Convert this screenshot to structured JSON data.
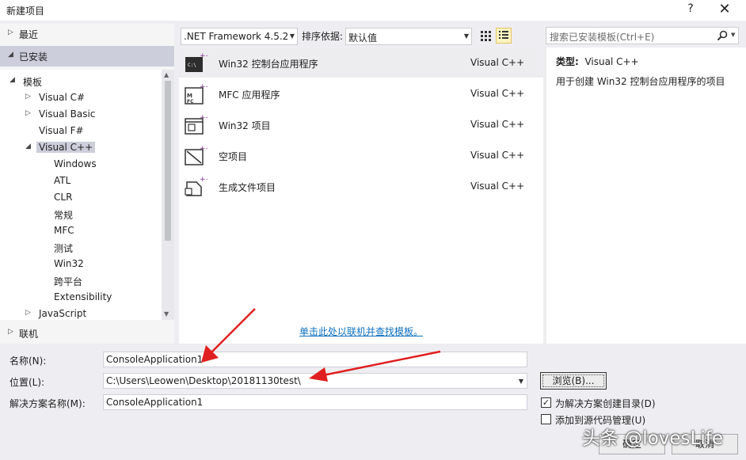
{
  "window": {
    "title": "新建项目",
    "help": "?",
    "close": "✕"
  },
  "left": {
    "recent": "最近",
    "installed": "已安装",
    "online": "联机",
    "tree": [
      {
        "label": "模板",
        "arrow": "◢",
        "indent": 12
      },
      {
        "label": "Visual C#",
        "arrow": "▷",
        "indent": 32
      },
      {
        "label": "Visual Basic",
        "arrow": "▷",
        "indent": 32
      },
      {
        "label": "Visual F#",
        "arrow": "",
        "indent": 32
      },
      {
        "label": "Visual C++",
        "arrow": "◢",
        "indent": 32,
        "selected": true
      },
      {
        "label": "Windows",
        "arrow": "",
        "indent": 51
      },
      {
        "label": "ATL",
        "arrow": "",
        "indent": 51
      },
      {
        "label": "CLR",
        "arrow": "",
        "indent": 51
      },
      {
        "label": "常规",
        "arrow": "",
        "indent": 51
      },
      {
        "label": "MFC",
        "arrow": "",
        "indent": 51
      },
      {
        "label": "测试",
        "arrow": "",
        "indent": 51
      },
      {
        "label": "Win32",
        "arrow": "",
        "indent": 51
      },
      {
        "label": "跨平台",
        "arrow": "",
        "indent": 51
      },
      {
        "label": "Extensibility",
        "arrow": "",
        "indent": 51
      },
      {
        "label": "JavaScript",
        "arrow": "▷",
        "indent": 32
      }
    ]
  },
  "toolbar": {
    "framework": ".NET Framework 4.5.2",
    "sort_label": "排序依据:",
    "sort_value": "默认值"
  },
  "search": {
    "placeholder": "搜索已安装模板(Ctrl+E)"
  },
  "templates": [
    {
      "name": "Win32 控制台应用程序",
      "lang": "Visual C++",
      "icon": "console-app-icon",
      "selected": true
    },
    {
      "name": "MFC 应用程序",
      "lang": "Visual C++",
      "icon": "mfc-app-icon"
    },
    {
      "name": "Win32 项目",
      "lang": "Visual C++",
      "icon": "win32-project-icon"
    },
    {
      "name": "空项目",
      "lang": "Visual C++",
      "icon": "empty-project-icon"
    },
    {
      "name": "生成文件项目",
      "lang": "Visual C++",
      "icon": "makefile-project-icon"
    }
  ],
  "online_link": "单击此处以联机并查找模板。",
  "details": {
    "type_key": "类型:",
    "type_value": "Visual C++",
    "description": "用于创建 Win32 控制台应用程序的项目"
  },
  "form": {
    "name_label": "名称(N):",
    "name_value": "ConsoleApplication1",
    "location_label": "位置(L):",
    "location_value": "C:\\Users\\Leowen\\Desktop\\20181130test\\",
    "solution_label": "解决方案名称(M):",
    "solution_value": "ConsoleApplication1",
    "browse": "浏览(B)...",
    "create_dir": "为解决方案创建目录(D)",
    "create_dir_checked": true,
    "add_source": "添加到源代码管理(U)",
    "add_source_checked": false,
    "ok": "确定",
    "cancel": "取消"
  },
  "watermark": "头条 @lovesLife",
  "colors": {
    "link": "#0e70c0",
    "selection": "#cccedb",
    "arrow": "#e02020"
  }
}
